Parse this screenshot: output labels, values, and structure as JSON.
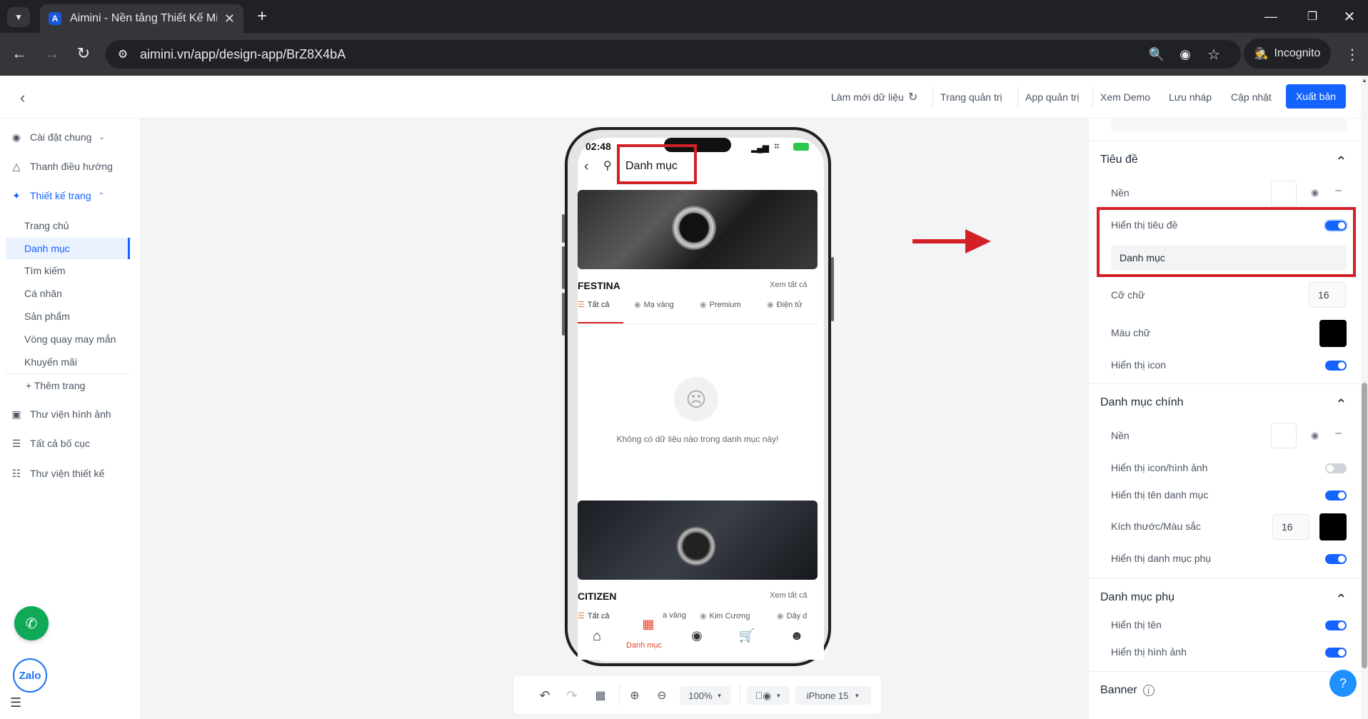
{
  "browser": {
    "tab_title": "Aimini - Nền tảng Thiết Kế Mini",
    "url": "aimini.vn/app/design-app/BrZ8X4bA",
    "incognito_label": "Incognito"
  },
  "toolbar": {
    "refresh_data": "Làm mới dữ liệu",
    "admin_page": "Trang quản trị",
    "admin_app": "App quản trị",
    "demo": "Xem Demo",
    "save_draft": "Lưu nháp",
    "update": "Cập nhật",
    "publish": "Xuất bản"
  },
  "sidebar": {
    "general_settings": "Cài đặt chung",
    "navigation_bar": "Thanh điều hướng",
    "page_design": "Thiết kế trang",
    "pages": [
      "Trang chủ",
      "Danh mục",
      "Tìm kiếm",
      "Cá nhân",
      "Sản phẩm",
      "Vòng quay may mắn",
      "Khuyến mãi"
    ],
    "add_page": "+ Thêm trang",
    "image_library": "Thư viện hình ảnh",
    "all_layouts": "Tất cả bố cục",
    "design_library": "Thư viện thiết kế",
    "zalo_label": "Zalo"
  },
  "phone": {
    "time": "02:48",
    "header_title": "Danh mục",
    "section1": {
      "brand": "FESTINA",
      "see_all": "Xem tất cả",
      "tabs": [
        "Tất cả",
        "Mạ vàng",
        "Premium",
        "Điện tử"
      ]
    },
    "empty_text": "Không có dữ liệu nào trong danh mục này!",
    "section2": {
      "brand": "CITIZEN",
      "see_all": "Xem tất cả",
      "tabs": [
        "Tất cả",
        "a vàng",
        "Kim Cương",
        "Dây d"
      ]
    },
    "nav_active_label": "Danh mục"
  },
  "bottom_toolbar": {
    "zoom": "100%",
    "device": "iPhone 15"
  },
  "right_panel": {
    "title_section": "Tiêu đề",
    "bg_label": "Nền",
    "show_title": "Hiển thị tiêu đề",
    "title_value": "Danh mục",
    "font_size_label": "Cỡ chữ",
    "font_size_value": "16",
    "text_color_label": "Màu chữ",
    "show_icon": "Hiển thị icon",
    "main_cat_section": "Danh mục chính",
    "main_bg_label": "Nền",
    "show_icon_image": "Hiển thị icon/hình ảnh",
    "show_cat_name": "Hiển thị tên danh mục",
    "size_color_label": "Kích thước/Màu sắc",
    "size_value": "16",
    "show_sub_cat": "Hiển thị danh mục phụ",
    "sub_cat_section": "Danh mục phụ",
    "show_name": "Hiển thị tên",
    "show_image": "Hiển thị hình ảnh",
    "banner_label": "Banner"
  },
  "colors": {
    "accent": "#1463ff",
    "annotation_red": "#d31f26"
  }
}
